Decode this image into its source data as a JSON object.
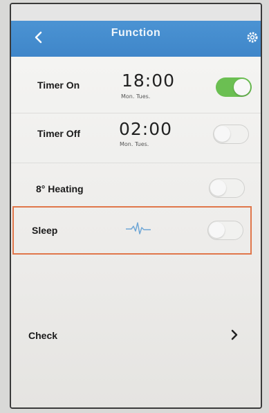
{
  "header": {
    "title": "Function",
    "back_icon": "chevron-left-icon",
    "settings_icon": "gear-icon",
    "color": "#4189cc"
  },
  "rows": [
    {
      "label": "Timer On",
      "time": "18:00",
      "days": "Mon. Tues.",
      "toggle": "on"
    },
    {
      "label": "Timer Off",
      "time": "02:00",
      "days": "Mon. Tues.",
      "toggle": "off"
    },
    {
      "label": "8° Heating",
      "toggle": "off"
    },
    {
      "label": "Sleep",
      "icon": "heartbeat-wave-icon",
      "toggle": "off",
      "highlighted": true
    },
    {
      "label": "Check",
      "icon": "chevron-right-icon"
    }
  ],
  "colors": {
    "toggle_on": "#6bbf52",
    "highlight_border": "#e0764a"
  }
}
